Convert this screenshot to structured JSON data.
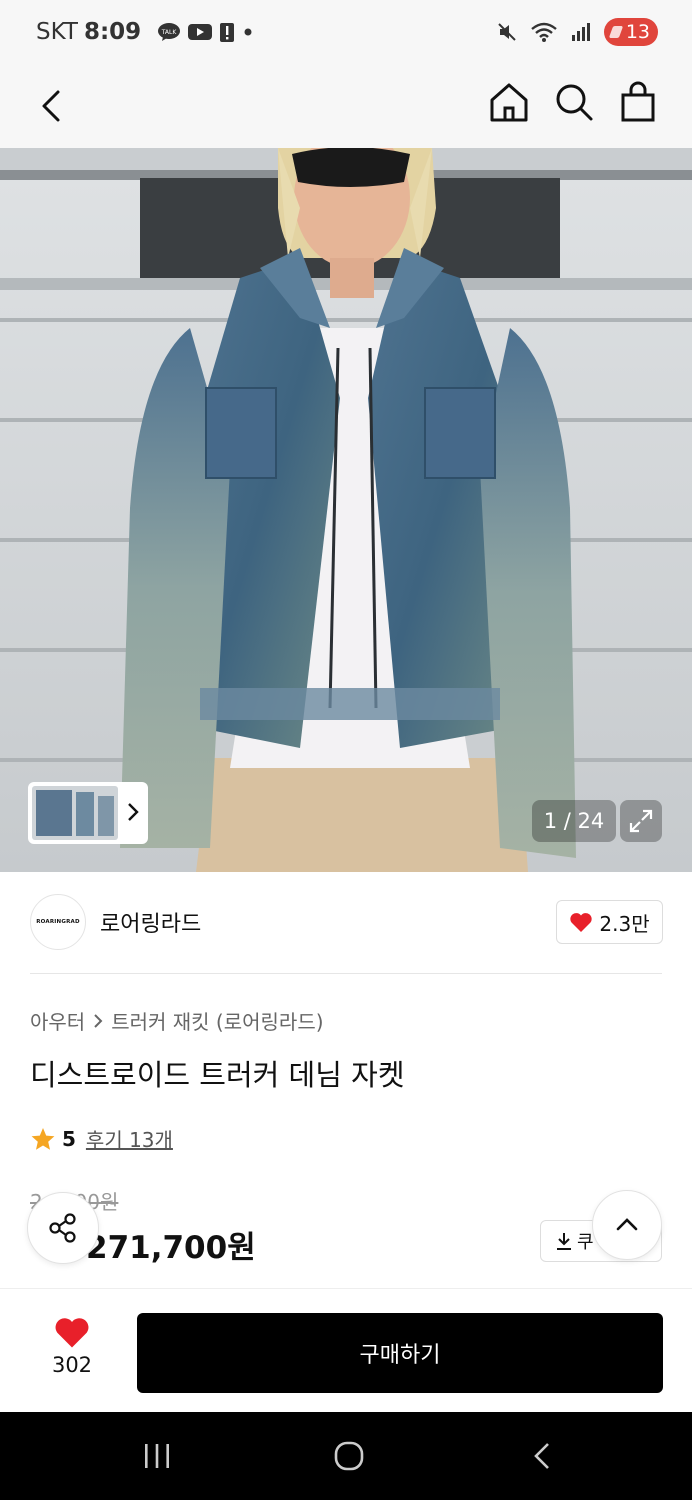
{
  "status_bar": {
    "carrier": "SKT",
    "time": "8:09",
    "battery_level": "13",
    "icons": [
      "kakaotalk-icon",
      "youtube-icon",
      "alert-icon",
      "mute-icon",
      "wifi-icon",
      "signal-icon"
    ]
  },
  "top_nav": {
    "icons": [
      "back-icon",
      "home-icon",
      "search-icon",
      "shopping-bag-icon"
    ]
  },
  "gallery": {
    "counter": "1 / 24"
  },
  "brand": {
    "logo_text": "ROARINGRAD",
    "name": "로어링라드",
    "likes": "2.3만"
  },
  "product": {
    "breadcrumb": [
      "아우터",
      "트러커 재킷 (로어링라드)"
    ],
    "title": "디스트로이드 트러커 데님 자켓",
    "rating": "5",
    "reviews": "후기 13개",
    "original_price": "2   000원",
    "discount_rate": "",
    "sale_price": "271,700원",
    "coupon_label": "쿠"
  },
  "bottom_bar": {
    "wish_count": "302",
    "buy_label": "구매하기"
  },
  "colors": {
    "accent_red": "#ff3b30",
    "heart_red": "#e8202a",
    "buy_button": "#000000",
    "nav_bg": "#f7f7f7"
  }
}
